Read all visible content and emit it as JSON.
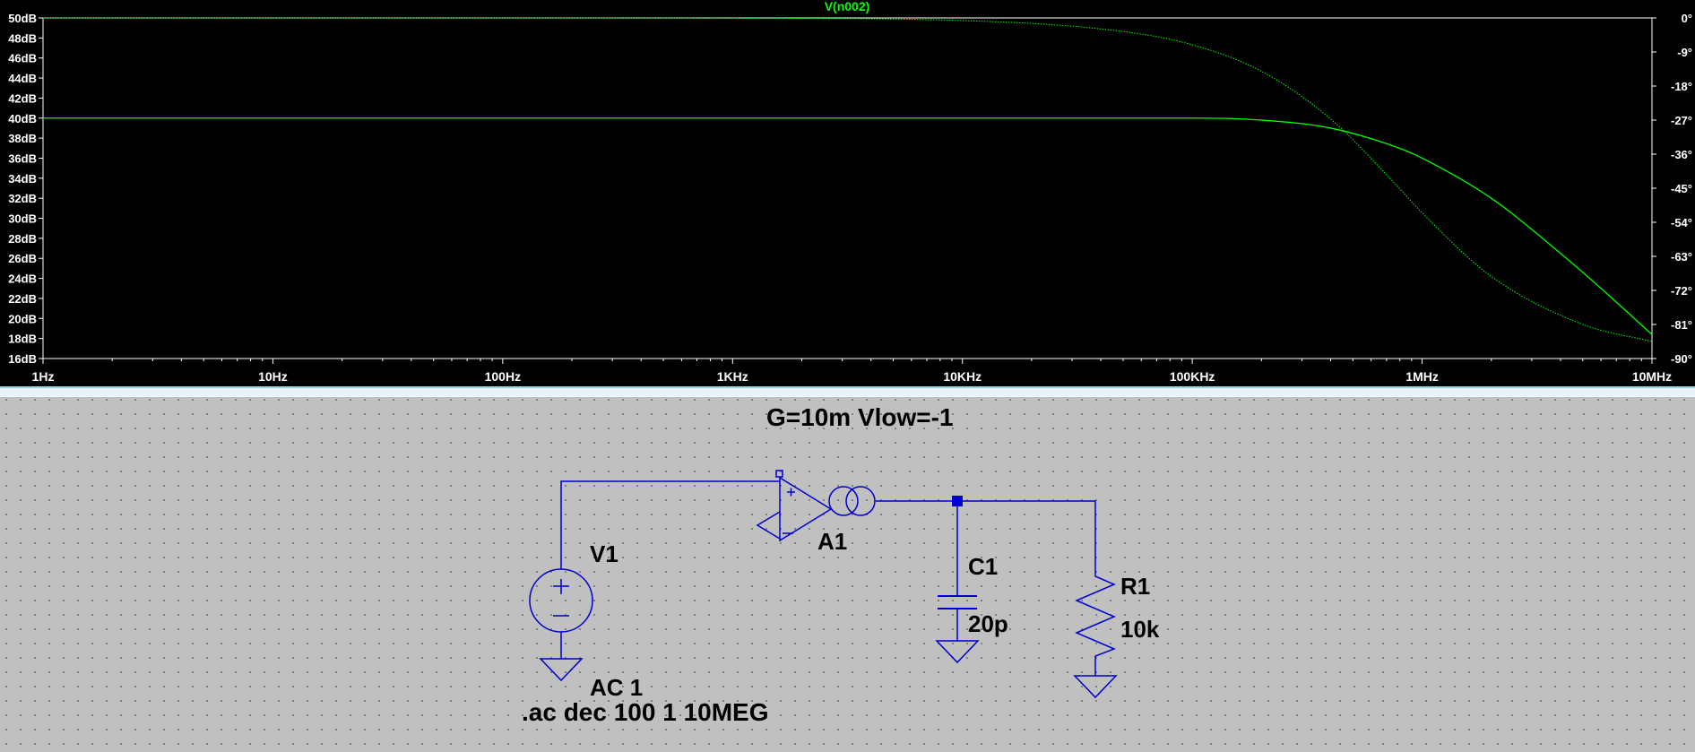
{
  "waveform": {
    "trace_label": "V(n002)",
    "trace_color": "#00ff00",
    "grid_color": "#ffffff"
  },
  "chart_data": {
    "type": "line",
    "title": "V(n002)",
    "x_scale": "log",
    "xlim": [
      1,
      10000000
    ],
    "x_ticks": [
      "1Hz",
      "10Hz",
      "100Hz",
      "1KHz",
      "10KHz",
      "100KHz",
      "1MHz",
      "10MHz"
    ],
    "left_axis": {
      "ylim": [
        16,
        50
      ],
      "ticks": [
        "50dB",
        "48dB",
        "46dB",
        "44dB",
        "42dB",
        "40dB",
        "38dB",
        "36dB",
        "34dB",
        "32dB",
        "30dB",
        "28dB",
        "26dB",
        "24dB",
        "22dB",
        "20dB",
        "18dB",
        "16dB"
      ]
    },
    "right_axis": {
      "ylim": [
        -90,
        0
      ],
      "ticks": [
        "0°",
        "-9°",
        "-18°",
        "-27°",
        "-36°",
        "-45°",
        "-54°",
        "-63°",
        "-72°",
        "-81°",
        "-90°"
      ]
    },
    "series": [
      {
        "name": "magnitude",
        "axis": "left",
        "style": "solid",
        "x": [
          1,
          10,
          100,
          1000,
          10000,
          100000,
          200000,
          400000,
          795000,
          1000000,
          2000000,
          4000000,
          6000000,
          10000000
        ],
        "y": [
          40,
          40,
          40,
          40,
          40,
          40,
          39.8,
          39.0,
          37.0,
          36.0,
          32.0,
          26.5,
          23.0,
          18.4
        ]
      },
      {
        "name": "phase",
        "axis": "right",
        "style": "dotted",
        "x": [
          1,
          10,
          100,
          1000,
          10000,
          50000,
          100000,
          200000,
          400000,
          795000,
          1000000,
          2000000,
          5000000,
          10000000
        ],
        "y": [
          0,
          0,
          0,
          -0.07,
          -0.7,
          -3.6,
          -7.1,
          -14.1,
          -26.7,
          -45,
          -51.5,
          -68.3,
          -81,
          -85.5
        ]
      }
    ]
  },
  "schematic": {
    "wire_color": "#0000cc",
    "directive": "G=10m Vlow=-1",
    "source": {
      "name": "V1",
      "value": "AC 1"
    },
    "amplifier": {
      "name": "A1",
      "plus": "+",
      "minus": "−"
    },
    "capacitor": {
      "name": "C1",
      "value": "20p"
    },
    "resistor": {
      "name": "R1",
      "value": "10k"
    },
    "command": ".ac dec 100 1 10MEG"
  }
}
